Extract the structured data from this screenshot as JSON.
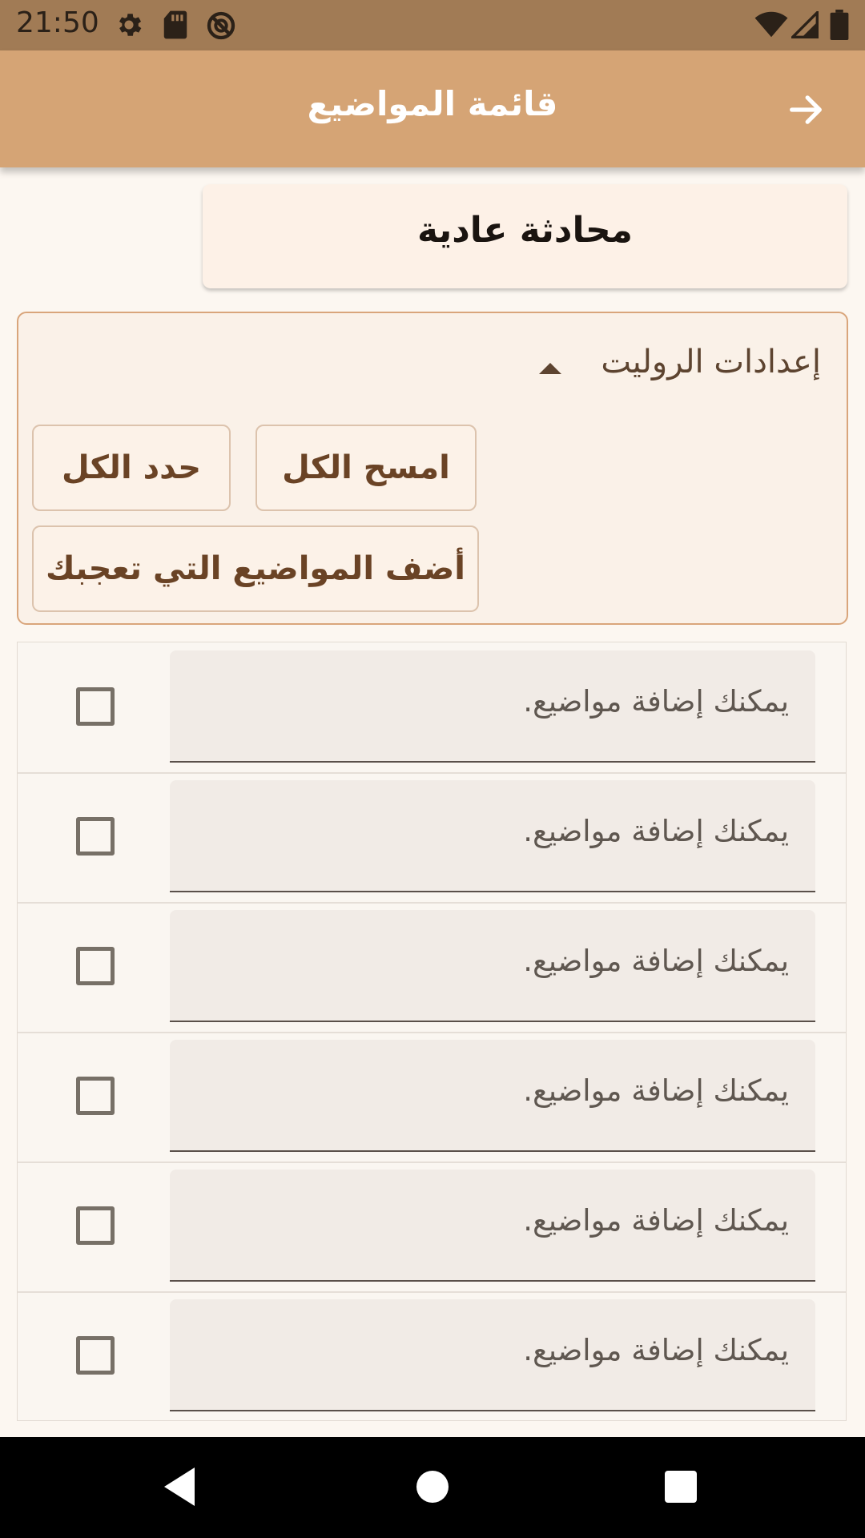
{
  "status_bar": {
    "time": "21:50",
    "left_icons": [
      "gear-icon",
      "sd-card-icon",
      "no-disturb-icon"
    ],
    "right_icons": [
      "wifi-icon",
      "signal-icon",
      "battery-icon"
    ]
  },
  "app_bar": {
    "title": "قائمة المواضيع",
    "back_icon": "arrow-right-icon"
  },
  "mode_card": {
    "label": "محادثة عادية"
  },
  "settings": {
    "title": "إعدادات الروليت",
    "collapse_icon": "caret-up-icon",
    "clear_all_label": "امسح الكل",
    "select_all_label": "حدد الكل",
    "add_topics_label": "أضف المواضيع التي تعجبك"
  },
  "topics": {
    "rows": [
      {
        "placeholder": "يمكنك إضافة مواضيع.",
        "checked": false
      },
      {
        "placeholder": "يمكنك إضافة مواضيع.",
        "checked": false
      },
      {
        "placeholder": "يمكنك إضافة مواضيع.",
        "checked": false
      },
      {
        "placeholder": "يمكنك إضافة مواضيع.",
        "checked": false
      },
      {
        "placeholder": "يمكنك إضافة مواضيع.",
        "checked": false
      },
      {
        "placeholder": "يمكنك إضافة مواضيع.",
        "checked": false
      }
    ]
  },
  "nav_bar": {
    "icons": [
      "back-triangle-icon",
      "home-circle-icon",
      "recents-square-icon"
    ]
  },
  "colors": {
    "status_bar": "#a17b55",
    "app_bar": "#d5a475",
    "accent_border": "#d9a57b",
    "button_text": "#6a4325",
    "background": "#fcf7f1"
  }
}
